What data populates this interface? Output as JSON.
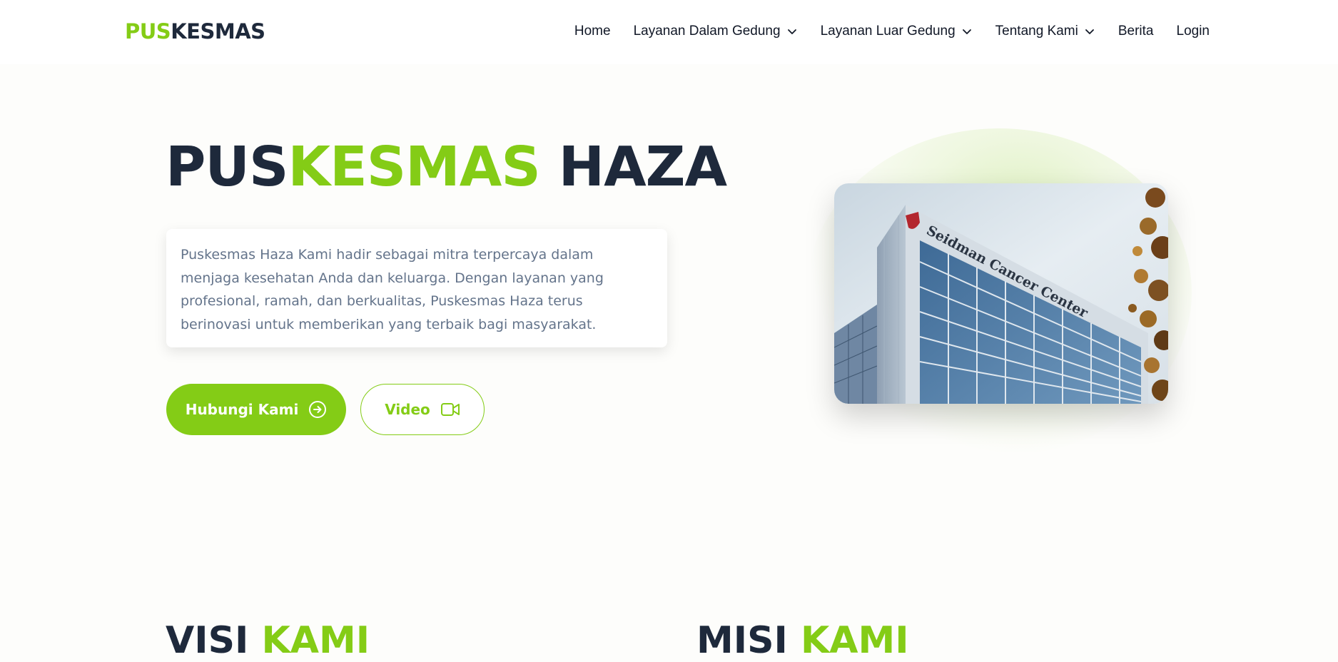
{
  "nav": {
    "logo_part1": "PUS",
    "logo_part2": "KESMAS",
    "items": [
      {
        "label": "Home",
        "dropdown": false
      },
      {
        "label": "Layanan Dalam Gedung",
        "dropdown": true
      },
      {
        "label": "Layanan Luar Gedung",
        "dropdown": true
      },
      {
        "label": "Tentang Kami",
        "dropdown": true
      },
      {
        "label": "Berita",
        "dropdown": false
      },
      {
        "label": "Login",
        "dropdown": false
      }
    ]
  },
  "hero": {
    "title_part1": "PUS",
    "title_part2": "KESMAS",
    "title_part3": "HAZA",
    "description": "Puskesmas Haza Kami hadir sebagai mitra terpercaya dalam menjaga kesehatan Anda dan keluarga. Dengan layanan yang profesional, ramah, dan berkualitas, Puskesmas Haza terus berinovasi untuk memberikan yang terbaik bagi masyarakat.",
    "primary_button": "Hubungi Kami",
    "secondary_button": "Video",
    "image_sign_text": "Seidman Cancer Center"
  },
  "sections": {
    "visi_part1": "VISI",
    "visi_part2": "KAMI",
    "misi_part1": "MISI",
    "misi_part2": "KAMI"
  },
  "colors": {
    "accent": "#84cc16",
    "dark": "#1e293b",
    "muted_text": "#64748b"
  }
}
